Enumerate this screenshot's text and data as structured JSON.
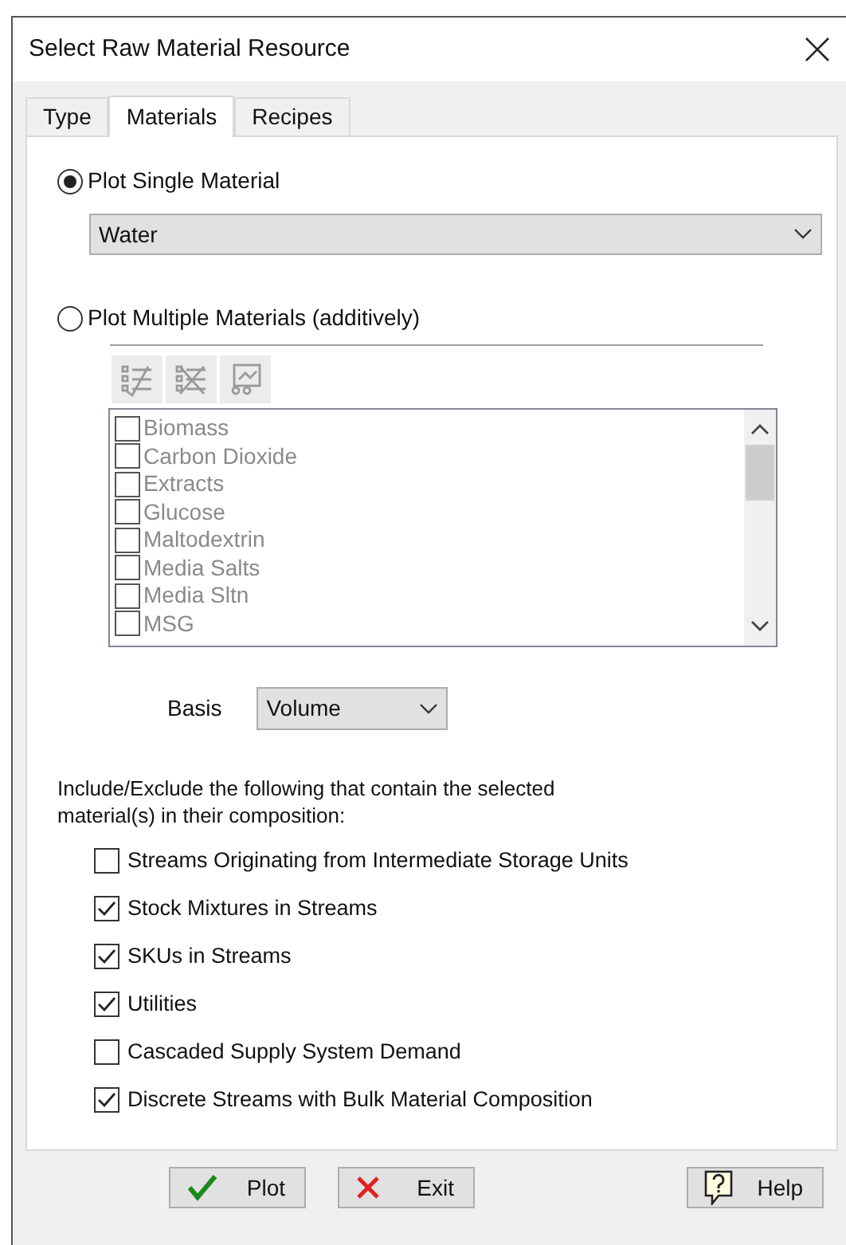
{
  "window": {
    "title": "Select Raw Material Resource"
  },
  "tabs": [
    {
      "label": "Type",
      "selected": false
    },
    {
      "label": "Materials",
      "selected": true
    },
    {
      "label": "Recipes",
      "selected": false
    }
  ],
  "single": {
    "label": "Plot Single Material",
    "selected": true,
    "value": "Water"
  },
  "multiple": {
    "label": "Plot Multiple Materials (additively)",
    "selected": false,
    "disabled": true,
    "materials": [
      {
        "name": "Biomass",
        "checked": false
      },
      {
        "name": "Carbon Dioxide",
        "checked": false
      },
      {
        "name": "Extracts",
        "checked": false
      },
      {
        "name": "Glucose",
        "checked": false
      },
      {
        "name": "Maltodextrin",
        "checked": false
      },
      {
        "name": "Media Salts",
        "checked": false
      },
      {
        "name": "Media Sltn",
        "checked": false
      },
      {
        "name": "MSG",
        "checked": false
      }
    ]
  },
  "basis": {
    "label": "Basis",
    "value": "Volume"
  },
  "include_text": "Include/Exclude the following that contain the selected material(s) in their composition:",
  "options": [
    {
      "label": "Streams Originating from Intermediate Storage Units",
      "checked": false
    },
    {
      "label": "Stock Mixtures in Streams",
      "checked": true
    },
    {
      "label": "SKUs in Streams",
      "checked": true
    },
    {
      "label": "Utilities",
      "checked": true
    },
    {
      "label": "Cascaded Supply System Demand",
      "checked": false
    },
    {
      "label": "Discrete Streams with Bulk Material Composition",
      "checked": true
    }
  ],
  "buttons": [
    {
      "label": "Plot",
      "kind": "ok"
    },
    {
      "label": "Exit",
      "kind": "cancel"
    },
    {
      "label": "Help",
      "kind": "help"
    }
  ]
}
